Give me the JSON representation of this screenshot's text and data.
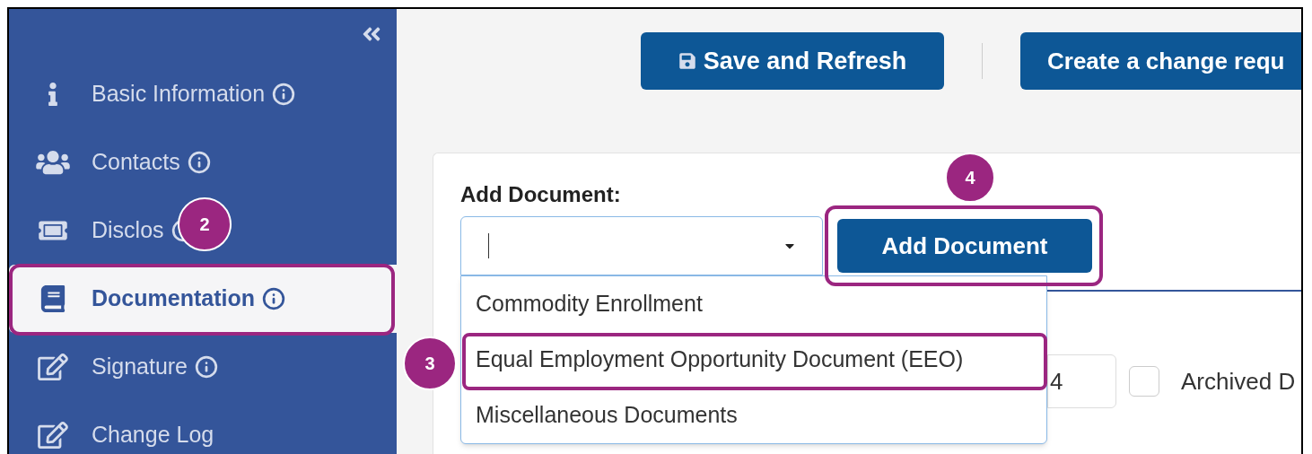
{
  "sidebar": {
    "items": [
      {
        "label": "Basic Information",
        "info_icon": true,
        "selected": false
      },
      {
        "label": "Contacts",
        "info_icon": true,
        "selected": false
      },
      {
        "label": "Disclos",
        "info_icon": true,
        "selected": false
      },
      {
        "label": "Documentation",
        "info_icon": true,
        "selected": true
      },
      {
        "label": "Signature",
        "info_icon": true,
        "selected": false
      },
      {
        "label": "Change Log",
        "info_icon": false,
        "selected": false
      }
    ]
  },
  "toolbar": {
    "buttons": [
      {
        "label": "Save and Refresh"
      },
      {
        "label": "Create a change requ"
      }
    ]
  },
  "add_document": {
    "title": "Add Document:",
    "select": {
      "expanded": true,
      "options": [
        {
          "label": "Commodity Enrollment",
          "selected": false
        },
        {
          "label": "Equal Employment Opportunity Document (EEO)",
          "selected": false
        },
        {
          "label": "Miscellaneous Documents",
          "selected": false
        }
      ]
    },
    "button": "Add Document"
  },
  "behind": {
    "field_value": "4",
    "checkbox": {
      "label": "Archived D",
      "checked": false
    }
  },
  "annotations": [
    {
      "label": "2"
    },
    {
      "label": "3"
    },
    {
      "label": "4"
    }
  ]
}
